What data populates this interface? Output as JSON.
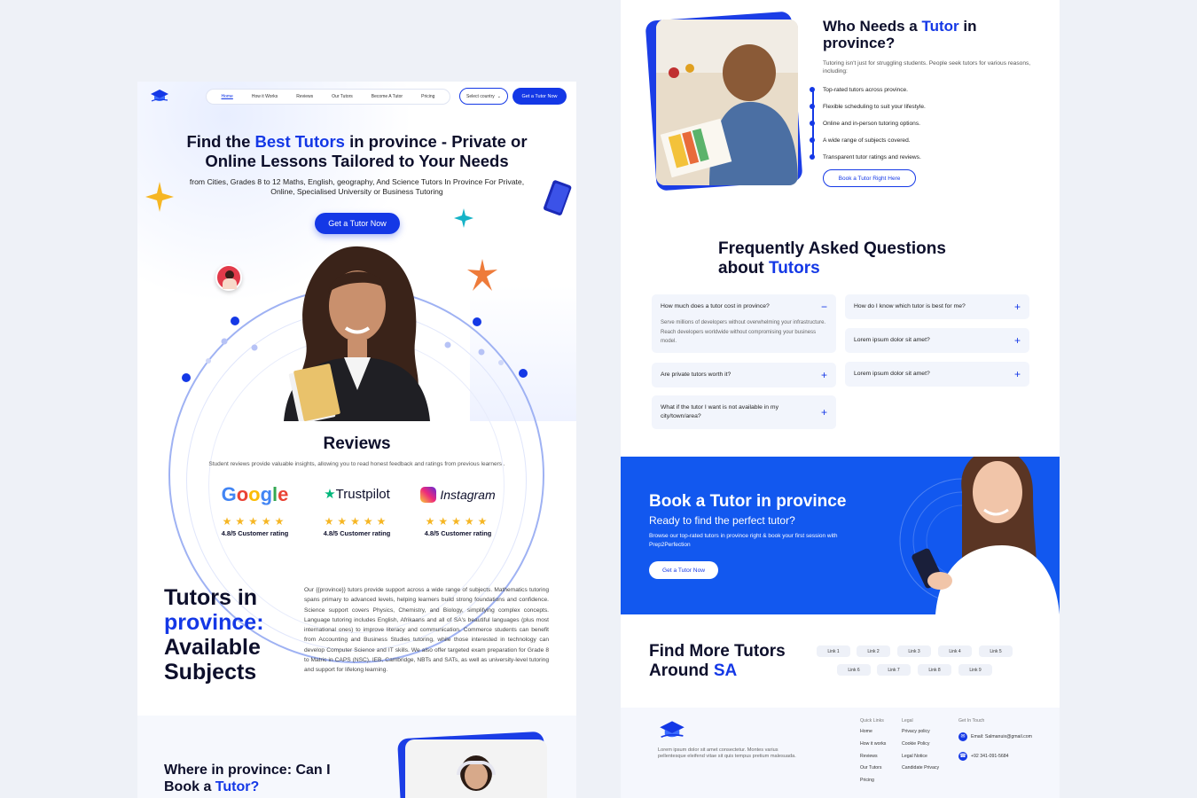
{
  "nav": {
    "items": [
      "Home",
      "How it Works",
      "Reviews",
      "Our Tutors",
      "Become A Tutor",
      "Pricing"
    ],
    "select_label": "Select country",
    "cta": "Get a Tutor Now"
  },
  "hero": {
    "title_pre": "Find the ",
    "title_accent": "Best Tutors",
    "title_post": " in province - Private or Online Lessons Tailored to Your Needs",
    "subtitle": "from Cities, Grades 8 to 12 Maths, English, geography, And Science Tutors In Province For Private, Online, Specialised University or Business Tutoring",
    "cta": "Get a Tutor Now"
  },
  "reviews": {
    "title": "Reviews",
    "subtitle": "Student reviews provide valuable insights, allowing you to read honest feedback and ratings from previous learners .",
    "platforms": [
      {
        "name": "Google",
        "rating": "4.8/5 Customer rating"
      },
      {
        "name": "Trustpilot",
        "rating": "4.8/5 Customer rating"
      },
      {
        "name": "Instagram",
        "rating": "4.8/5 Customer rating"
      }
    ],
    "stars": "★★★★★"
  },
  "subjects": {
    "title_1": "Tutors in",
    "title_accent": "province:",
    "title_2": "Available Subjects",
    "text": "Our {{province}} tutors provide support across a wide range of subjects. Mathematics tutoring spans primary to advanced levels, helping learners build strong foundations and confidence. Science support covers Physics, Chemistry, and Biology, simplifying complex concepts. Language tutoring includes English, Afrikaans and all of SA's beautiful languages (plus most international ones) to improve literacy and communication. Commerce students can benefit from Accounting and Business Studies tutoring, while those interested in technology can develop Computer Science and IT skills. We also offer targeted exam preparation for Grade 8 to Matric in CAPS (NSC), IEB, Cambridge, NBTs and SATs, as well as university-level tutoring and support for lifelong learning."
  },
  "where": {
    "title_1": "Where in province: Can I",
    "title_2": "Book a ",
    "title_accent": "Tutor?"
  },
  "who": {
    "title_pre": "Who Needs a ",
    "title_accent": "Tutor",
    "title_post": " in province?",
    "subtitle": "Tutoring isn't just for struggling students. People seek tutors for various reasons, including:",
    "points": [
      "Top-rated tutors across province.",
      "Flexible scheduling to suit your lifestyle.",
      "Online and in-person tutoring options.",
      "A wide range of subjects covered.",
      "Transparent tutor ratings and reviews."
    ],
    "cta": "Book a Tutor Right Here"
  },
  "faq": {
    "title_1": "Frequently Asked Questions",
    "title_2": "about ",
    "title_accent": "Tutors",
    "items": [
      {
        "q": "How much does a tutor cost in province?",
        "icon": "−",
        "a": "Serve millions of developers without overwhelming your infrastructure. Reach developers worldwide without compromising your business model."
      },
      {
        "q": "Are private tutors worth it?",
        "icon": "+"
      },
      {
        "q": "What if the tutor I want is not available in my city/town/area?",
        "icon": "+"
      },
      {
        "q": "How do I know which tutor is best for me?",
        "icon": "+"
      },
      {
        "q": "Lorem ipsum dolor sit amet?",
        "icon": "+"
      },
      {
        "q": "Lorem ipsum dolor sit amet?",
        "icon": "+"
      }
    ]
  },
  "book": {
    "title": "Book a Tutor in province",
    "subtitle": "Ready to find the perfect tutor?",
    "text": "Browse our top-rated tutors in province right & book your first session with Prep2Perfection",
    "cta": "Get a Tutor Now"
  },
  "find": {
    "title_1": "Find More Tutors",
    "title_2": "Around ",
    "title_accent": "SA",
    "links": [
      "Link 1",
      "Link 2",
      "Link 3",
      "Link 4",
      "Link 5",
      "Link 6",
      "Link 7",
      "Link 8",
      "Link 9"
    ]
  },
  "footer": {
    "desc": "Lorem ipsum dolor sit amet consectetur. Montes varius pellentesque eleifend vitae sit quis tempus pretium malesuada.",
    "quick_title": "Quick Links",
    "quick": [
      "Home",
      "How it works",
      "Reviews",
      "Our Tutors",
      "Pricing"
    ],
    "legal_title": "Legal",
    "legal": [
      "Privacy policy",
      "Cookie Policy",
      "Legal Notice",
      "Candidate Privacy"
    ],
    "contact_title": "Get In Touch",
    "email": "Email: Salmanuix@gmail.com",
    "phone": "+92 341-091-5684"
  },
  "colors": {
    "accent": "#1438e6",
    "banner": "#1258ef",
    "star": "#f6b623"
  }
}
